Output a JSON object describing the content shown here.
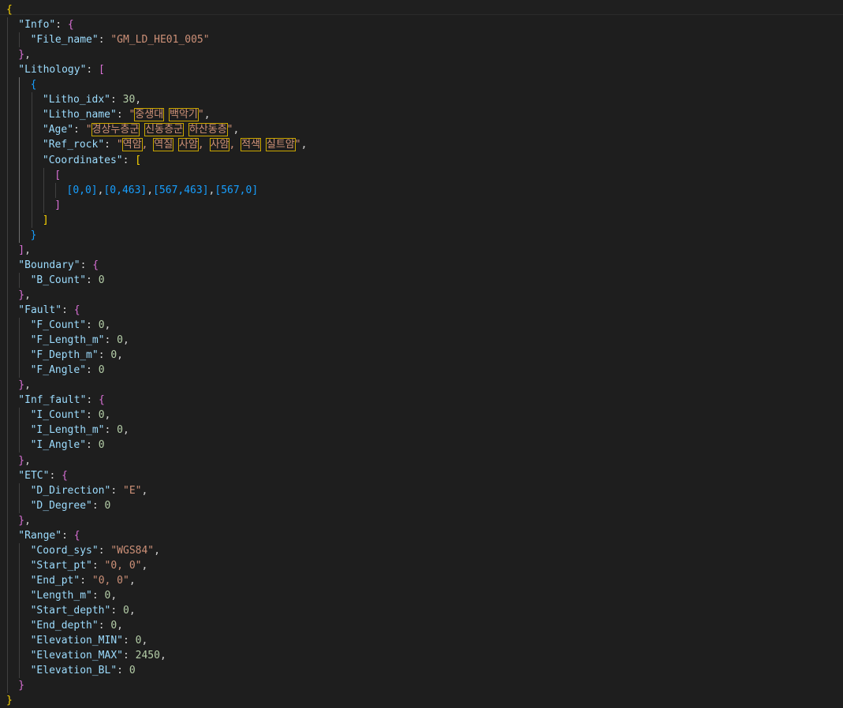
{
  "colors": {
    "background": "#1e1e1e",
    "key": "#9cdcfe",
    "string": "#ce9178",
    "number": "#b5cea8",
    "bracket_level1": "#ffd700",
    "bracket_level2": "#da70d6",
    "bracket_level3": "#179fff",
    "unicode_highlight_border": "#cca700"
  },
  "document": {
    "lines": [
      [
        {
          "t": "{",
          "c": "b1"
        }
      ],
      [
        {
          "t": "\"Info\"",
          "c": "key"
        },
        {
          "t": ": ",
          "c": "p"
        },
        {
          "t": "{",
          "c": "b2"
        }
      ],
      [
        {
          "t": "\"File_name\"",
          "c": "key"
        },
        {
          "t": ": ",
          "c": "p"
        },
        {
          "t": "\"GM_LD_HE01_005\"",
          "c": "str"
        }
      ],
      [
        {
          "t": "}",
          "c": "b2"
        },
        {
          "t": ",",
          "c": "p"
        }
      ],
      [
        {
          "t": "\"Lithology\"",
          "c": "key"
        },
        {
          "t": ": ",
          "c": "p"
        },
        {
          "t": "[",
          "c": "b2"
        }
      ],
      [
        {
          "t": "{",
          "c": "b3"
        }
      ],
      [
        {
          "t": "\"Litho_idx\"",
          "c": "key"
        },
        {
          "t": ": ",
          "c": "p"
        },
        {
          "t": "30",
          "c": "num"
        },
        {
          "t": ",",
          "c": "p"
        }
      ],
      [
        {
          "t": "\"Litho_name\"",
          "c": "key"
        },
        {
          "t": ": ",
          "c": "p"
        },
        {
          "t": "\"",
          "c": "str"
        },
        {
          "t": "중생대",
          "c": "str",
          "h": true
        },
        {
          "t": " ",
          "c": "str"
        },
        {
          "t": "백악기",
          "c": "str",
          "h": true
        },
        {
          "t": "\"",
          "c": "str"
        },
        {
          "t": ",",
          "c": "p"
        }
      ],
      [
        {
          "t": "\"Age\"",
          "c": "key"
        },
        {
          "t": ": ",
          "c": "p"
        },
        {
          "t": "\"",
          "c": "str"
        },
        {
          "t": "경상누층군",
          "c": "str",
          "h": true
        },
        {
          "t": " ",
          "c": "str"
        },
        {
          "t": "신동층군",
          "c": "str",
          "h": true
        },
        {
          "t": " ",
          "c": "str"
        },
        {
          "t": "하산동층",
          "c": "str",
          "h": true
        },
        {
          "t": "\"",
          "c": "str"
        },
        {
          "t": ",",
          "c": "p"
        }
      ],
      [
        {
          "t": "\"Ref_rock\"",
          "c": "key"
        },
        {
          "t": ": ",
          "c": "p"
        },
        {
          "t": "\"",
          "c": "str"
        },
        {
          "t": "역암",
          "c": "str",
          "h": true
        },
        {
          "t": ", ",
          "c": "str"
        },
        {
          "t": "역질",
          "c": "str",
          "h": true
        },
        {
          "t": " ",
          "c": "str"
        },
        {
          "t": "사암",
          "c": "str",
          "h": true
        },
        {
          "t": ", ",
          "c": "str"
        },
        {
          "t": "사암",
          "c": "str",
          "h": true
        },
        {
          "t": ", ",
          "c": "str"
        },
        {
          "t": "적색",
          "c": "str",
          "h": true
        },
        {
          "t": " ",
          "c": "str"
        },
        {
          "t": "실트암",
          "c": "str",
          "h": true
        },
        {
          "t": "\"",
          "c": "str"
        },
        {
          "t": ",",
          "c": "p"
        }
      ],
      [
        {
          "t": "\"Coordinates\"",
          "c": "key"
        },
        {
          "t": ": ",
          "c": "p"
        },
        {
          "t": "[",
          "c": "b1"
        }
      ],
      [
        {
          "t": "[",
          "c": "b2"
        }
      ],
      [
        {
          "t": "[0,0]",
          "c": "b3"
        },
        {
          "t": ",",
          "c": "p"
        },
        {
          "t": "[0,463]",
          "c": "b3"
        },
        {
          "t": ",",
          "c": "p"
        },
        {
          "t": "[567,463]",
          "c": "b3"
        },
        {
          "t": ",",
          "c": "p"
        },
        {
          "t": "[567,0]",
          "c": "b3"
        }
      ],
      [
        {
          "t": "]",
          "c": "b2"
        }
      ],
      [
        {
          "t": "]",
          "c": "b1"
        }
      ],
      [
        {
          "t": "}",
          "c": "b3"
        }
      ],
      [
        {
          "t": "]",
          "c": "b2"
        },
        {
          "t": ",",
          "c": "p"
        }
      ],
      [
        {
          "t": "\"Boundary\"",
          "c": "key"
        },
        {
          "t": ": ",
          "c": "p"
        },
        {
          "t": "{",
          "c": "b2"
        }
      ],
      [
        {
          "t": "\"B_Count\"",
          "c": "key"
        },
        {
          "t": ": ",
          "c": "p"
        },
        {
          "t": "0",
          "c": "num"
        }
      ],
      [
        {
          "t": "}",
          "c": "b2"
        },
        {
          "t": ",",
          "c": "p"
        }
      ],
      [
        {
          "t": "\"Fault\"",
          "c": "key"
        },
        {
          "t": ": ",
          "c": "p"
        },
        {
          "t": "{",
          "c": "b2"
        }
      ],
      [
        {
          "t": "\"F_Count\"",
          "c": "key"
        },
        {
          "t": ": ",
          "c": "p"
        },
        {
          "t": "0",
          "c": "num"
        },
        {
          "t": ",",
          "c": "p"
        }
      ],
      [
        {
          "t": "\"F_Length_m\"",
          "c": "key"
        },
        {
          "t": ": ",
          "c": "p"
        },
        {
          "t": "0",
          "c": "num"
        },
        {
          "t": ",",
          "c": "p"
        }
      ],
      [
        {
          "t": "\"F_Depth_m\"",
          "c": "key"
        },
        {
          "t": ": ",
          "c": "p"
        },
        {
          "t": "0",
          "c": "num"
        },
        {
          "t": ",",
          "c": "p"
        }
      ],
      [
        {
          "t": "\"F_Angle\"",
          "c": "key"
        },
        {
          "t": ": ",
          "c": "p"
        },
        {
          "t": "0",
          "c": "num"
        }
      ],
      [
        {
          "t": "}",
          "c": "b2"
        },
        {
          "t": ",",
          "c": "p"
        }
      ],
      [
        {
          "t": "\"Inf_fault\"",
          "c": "key"
        },
        {
          "t": ": ",
          "c": "p"
        },
        {
          "t": "{",
          "c": "b2"
        }
      ],
      [
        {
          "t": "\"I_Count\"",
          "c": "key"
        },
        {
          "t": ": ",
          "c": "p"
        },
        {
          "t": "0",
          "c": "num"
        },
        {
          "t": ",",
          "c": "p"
        }
      ],
      [
        {
          "t": "\"I_Length_m\"",
          "c": "key"
        },
        {
          "t": ": ",
          "c": "p"
        },
        {
          "t": "0",
          "c": "num"
        },
        {
          "t": ",",
          "c": "p"
        }
      ],
      [
        {
          "t": "\"I_Angle\"",
          "c": "key"
        },
        {
          "t": ": ",
          "c": "p"
        },
        {
          "t": "0",
          "c": "num"
        }
      ],
      [
        {
          "t": "}",
          "c": "b2"
        },
        {
          "t": ",",
          "c": "p"
        }
      ],
      [
        {
          "t": "\"ETC\"",
          "c": "key"
        },
        {
          "t": ": ",
          "c": "p"
        },
        {
          "t": "{",
          "c": "b2"
        }
      ],
      [
        {
          "t": "\"D_Direction\"",
          "c": "key"
        },
        {
          "t": ": ",
          "c": "p"
        },
        {
          "t": "\"E\"",
          "c": "str"
        },
        {
          "t": ",",
          "c": "p"
        }
      ],
      [
        {
          "t": "\"D_Degree\"",
          "c": "key"
        },
        {
          "t": ": ",
          "c": "p"
        },
        {
          "t": "0",
          "c": "num"
        }
      ],
      [
        {
          "t": "}",
          "c": "b2"
        },
        {
          "t": ",",
          "c": "p"
        }
      ],
      [
        {
          "t": "\"Range\"",
          "c": "key"
        },
        {
          "t": ": ",
          "c": "p"
        },
        {
          "t": "{",
          "c": "b2"
        }
      ],
      [
        {
          "t": "\"Coord_sys\"",
          "c": "key"
        },
        {
          "t": ": ",
          "c": "p"
        },
        {
          "t": "\"WGS84\"",
          "c": "str"
        },
        {
          "t": ",",
          "c": "p"
        }
      ],
      [
        {
          "t": "\"Start_pt\"",
          "c": "key"
        },
        {
          "t": ": ",
          "c": "p"
        },
        {
          "t": "\"0, 0\"",
          "c": "str"
        },
        {
          "t": ",",
          "c": "p"
        }
      ],
      [
        {
          "t": "\"End_pt\"",
          "c": "key"
        },
        {
          "t": ": ",
          "c": "p"
        },
        {
          "t": "\"0, 0\"",
          "c": "str"
        },
        {
          "t": ",",
          "c": "p"
        }
      ],
      [
        {
          "t": "\"Length_m\"",
          "c": "key"
        },
        {
          "t": ": ",
          "c": "p"
        },
        {
          "t": "0",
          "c": "num"
        },
        {
          "t": ",",
          "c": "p"
        }
      ],
      [
        {
          "t": "\"Start_depth\"",
          "c": "key"
        },
        {
          "t": ": ",
          "c": "p"
        },
        {
          "t": "0",
          "c": "num"
        },
        {
          "t": ",",
          "c": "p"
        }
      ],
      [
        {
          "t": "\"End_depth\"",
          "c": "key"
        },
        {
          "t": ": ",
          "c": "p"
        },
        {
          "t": "0",
          "c": "num"
        },
        {
          "t": ",",
          "c": "p"
        }
      ],
      [
        {
          "t": "\"Elevation_MIN\"",
          "c": "key"
        },
        {
          "t": ": ",
          "c": "p"
        },
        {
          "t": "0",
          "c": "num"
        },
        {
          "t": ",",
          "c": "p"
        }
      ],
      [
        {
          "t": "\"Elevation_MAX\"",
          "c": "key"
        },
        {
          "t": ": ",
          "c": "p"
        },
        {
          "t": "2450",
          "c": "num"
        },
        {
          "t": ",",
          "c": "p"
        }
      ],
      [
        {
          "t": "\"Elevation_BL\"",
          "c": "key"
        },
        {
          "t": ": ",
          "c": "p"
        },
        {
          "t": "0",
          "c": "num"
        }
      ],
      [
        {
          "t": "}",
          "c": "b2"
        }
      ],
      [
        {
          "t": "}",
          "c": "b1"
        }
      ]
    ]
  }
}
